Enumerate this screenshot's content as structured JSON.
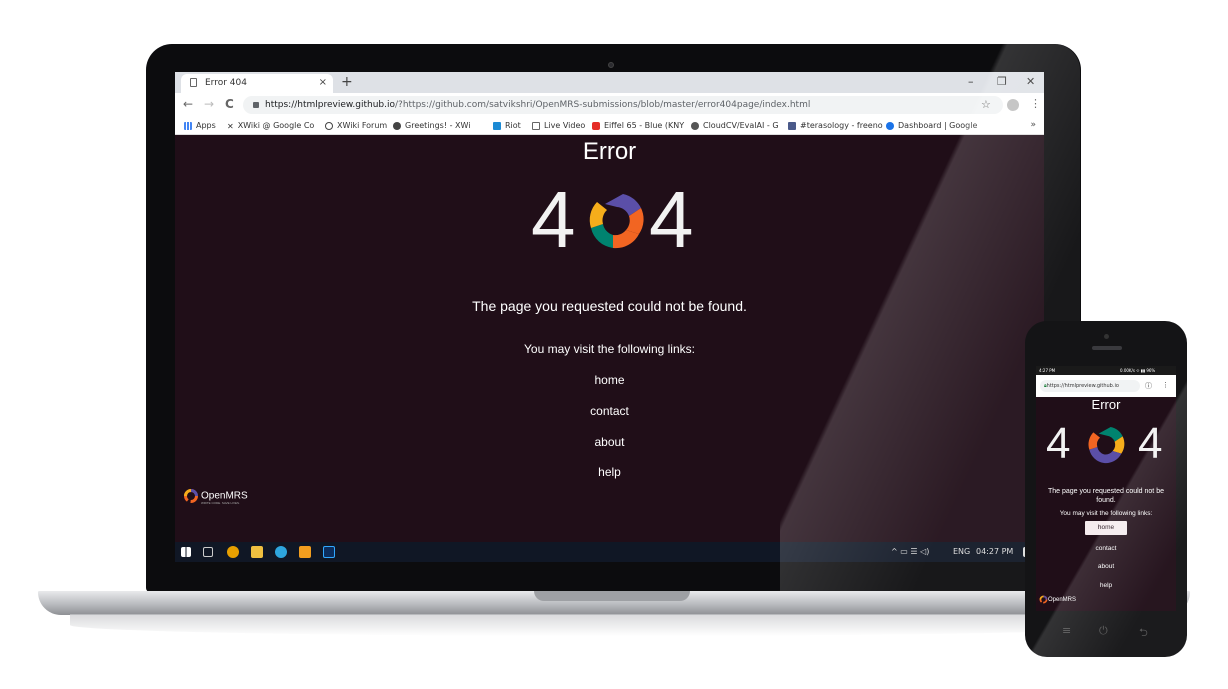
{
  "browser": {
    "tab_title": "Error 404",
    "tab_close": "×",
    "new_tab": "+",
    "window_controls": [
      "–",
      "❐",
      "✕"
    ],
    "nav": [
      "←",
      "→",
      "C"
    ],
    "url_host": "https://htmlpreview.github.io",
    "url_rest": "/?https://github.com/satvikshri/OpenMRS-submissions/blob/master/error404page/index.html",
    "star": "☆",
    "menu": "⋮",
    "bookmarks": [
      {
        "label": "Apps",
        "icon": "apps-grid-icon",
        "color": "#4285f4"
      },
      {
        "label": "XWiki @ Google Co",
        "icon": "xwiki-icon",
        "color": "#333333"
      },
      {
        "label": "XWiki Forum",
        "icon": "discourse-icon",
        "color": "#444444"
      },
      {
        "label": "Greetings! - XWi",
        "icon": "greetings-icon",
        "color": "#444444"
      },
      {
        "label": "Riot",
        "icon": "riot-icon",
        "color": "#1c8ad4"
      },
      {
        "label": "Live Video",
        "icon": "document-icon",
        "color": "#666666"
      },
      {
        "label": "Eiffel 65 - Blue (KNY",
        "icon": "youtube-icon",
        "color": "#e52d27"
      },
      {
        "label": "CloudCV/EvalAI - G",
        "icon": "github-icon",
        "color": "#444444"
      },
      {
        "label": "#terasology - freeno",
        "icon": "irc-icon",
        "color": "#4b5a8a"
      },
      {
        "label": "Dashboard | Google",
        "icon": "gear-icon",
        "color": "#1a73e8"
      }
    ],
    "more_bookmarks": "»"
  },
  "page": {
    "title": "Error",
    "digit_left": "4",
    "digit_right": "4",
    "message": "The page you requested could not be found.",
    "subtext": "You may visit the following links:",
    "links": [
      "home",
      "contact",
      "about",
      "help"
    ],
    "brand": "OpenMRS",
    "brand_tagline": "WRITE CODE. SAVE LIVES."
  },
  "taskbar": {
    "language": "ENG",
    "time": "04:27 PM",
    "tray": "^ ▭ ☰ ◁)"
  },
  "phone": {
    "status_time": "4:27 PM",
    "status_right": "0.00K/s ⟐ ▮▮ 96%",
    "url": "https://htmlpreview.github.io",
    "info_icon": "ⓘ",
    "menu": "⋮",
    "title": "Error",
    "digit_left": "4",
    "digit_right": "4",
    "message": "The page you requested could not be found.",
    "subtext": "You may visit the following links:",
    "links": [
      "home",
      "contact",
      "about",
      "help"
    ],
    "brand": "OpenMRS",
    "nav_buttons": [
      "≡",
      "⏻",
      "⮌"
    ]
  },
  "logo_colors": {
    "purple": "#5b4fa8",
    "orange": "#f26522",
    "yellow": "#f6ad1b",
    "teal": "#00836f"
  }
}
